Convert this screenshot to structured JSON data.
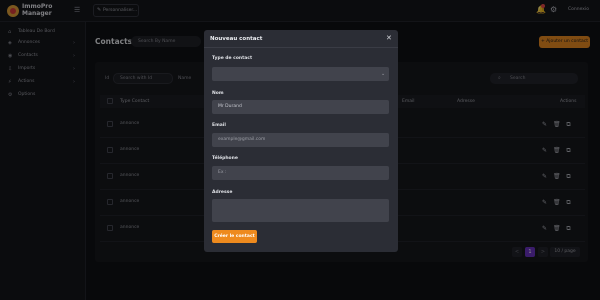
{
  "app": {
    "logo_line1": "ImmoPro",
    "logo_line2": "Manager",
    "personalise_label": "Personnaliser...",
    "connect_label": "Connexio"
  },
  "sidebar": {
    "items": [
      {
        "label": "Tableau De Bord",
        "icon": "home-icon",
        "has_chevron": false
      },
      {
        "label": "Annonces",
        "icon": "megaphone-icon",
        "has_chevron": true
      },
      {
        "label": "Contacts",
        "icon": "contacts-icon",
        "has_chevron": true
      },
      {
        "label": "Imports",
        "icon": "import-icon",
        "has_chevron": true
      },
      {
        "label": "Actions",
        "icon": "bolt-icon",
        "has_chevron": true
      },
      {
        "label": "Options",
        "icon": "settings-icon",
        "has_chevron": false
      }
    ]
  },
  "page": {
    "title": "Contacts",
    "search_placeholder": "Search By Name",
    "add_button": "+ Ajouter un contact"
  },
  "filters": {
    "id_label": "Id",
    "id_placeholder": "Search with Id",
    "name_label": "Name",
    "search_placeholder": "Search"
  },
  "table": {
    "headers": {
      "type": "Type Contact",
      "email": "Email",
      "address": "Adresse",
      "actions": "Actions"
    },
    "rows": [
      {
        "type": "annonce"
      },
      {
        "type": "annonce"
      },
      {
        "type": "annonce"
      },
      {
        "type": "annonce"
      },
      {
        "type": "annonce"
      }
    ]
  },
  "pagination": {
    "prev": "<",
    "current": "1",
    "next": ">",
    "page_size": "10 / page"
  },
  "modal": {
    "title": "Nouveau contact",
    "close": "✕",
    "type_label": "Type de contact",
    "type_value": "",
    "name_label": "Nom",
    "name_value": "Mr Durand",
    "email_label": "Email",
    "email_placeholder": "example@gmail.com",
    "phone_label": "Téléphone",
    "phone_placeholder": "Ex :",
    "address_label": "Adresse",
    "address_value": "",
    "submit": "Créer le contact"
  },
  "colors": {
    "accent": "#ee8a1e",
    "pagination_active": "#6a33c2"
  }
}
